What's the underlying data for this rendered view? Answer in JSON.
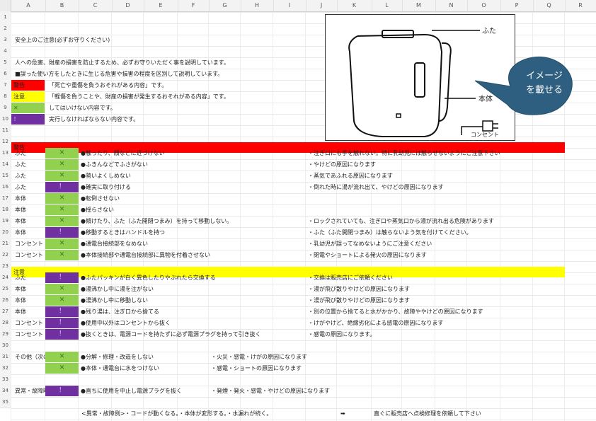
{
  "columns": [
    "A",
    "B",
    "C",
    "D",
    "E",
    "F",
    "G",
    "H",
    "I",
    "J",
    "K",
    "L",
    "M",
    "N",
    "O",
    "P",
    "Q",
    "R"
  ],
  "rows": [
    "1",
    "2",
    "3",
    "4",
    "5",
    "6",
    "7",
    "8",
    "9",
    "10",
    "11",
    "12",
    "13",
    "14",
    "15",
    "16",
    "17",
    "18",
    "19",
    "20",
    "21",
    "22",
    "23",
    "24",
    "25",
    "26",
    "27",
    "28",
    "29",
    "30",
    "31",
    "32",
    "33",
    "34",
    "35"
  ],
  "intro": {
    "title": "安全上のご注意(必ずお守りください)",
    "line1": "人への危害、財産の損害を防止するため、必ずお守りいただく事を説明しています。",
    "line2": "■誤った使い方をしたときに生じる危害や損害の程度を区別して説明しています。"
  },
  "legend": {
    "warning_label": "警告",
    "warning_text": "「死亡や重傷を負うおそれがある内容」です。",
    "caution_label": "注意",
    "caution_text": "「軽傷を負うことや、財産の損害が発生するおそれがある内容」です。",
    "prohibit_symbol": "✕",
    "prohibit_text": "してはいけない内容です。",
    "mandatory_symbol": "！",
    "mandatory_text": "実行しなければならない内容です。"
  },
  "sections": {
    "warning": "警告",
    "caution": "注意",
    "other": "その他（次の点も注意）",
    "abnormal": "異常・故障時は…"
  },
  "table_rows": [
    {
      "row": 13,
      "part": "ふた",
      "type": "x",
      "action": "●触ったり、顔などに近づけない",
      "note": "・注ぎ口にも手を触れない。特に乳幼児には触らせないようにご注意下さい"
    },
    {
      "row": 14,
      "part": "ふた",
      "type": "x",
      "action": "●ふきんなどでふさがない",
      "note": "・やけどの原因になります"
    },
    {
      "row": 15,
      "part": "ふた",
      "type": "x",
      "action": "●勢いよくしめない",
      "note": "・蒸気であふれる原因になります"
    },
    {
      "row": 16,
      "part": "ふた",
      "type": "!",
      "action": "●確実に取り付ける",
      "note": "・倒れた時に湯が流れ出て、やけどの原因になります"
    },
    {
      "row": 17,
      "part": "本体",
      "type": "x",
      "action": "●転倒させない",
      "note": ""
    },
    {
      "row": 18,
      "part": "本体",
      "type": "x",
      "action": "●揺らさない",
      "note": ""
    },
    {
      "row": 19,
      "part": "本体",
      "type": "x",
      "action": "●傾けたり、ふた（ふた開閉つまみ）を持って移動しない。",
      "note": "・ロックされていても、注ぎ口や蒸気口から湯が流れ出る危険があります"
    },
    {
      "row": 20,
      "part": "本体",
      "type": "!",
      "action": "●移動するときはハンドルを持つ",
      "note": "・ふた（ふた開閉つまみ）は触らないよう気を付けてください。"
    },
    {
      "row": 21,
      "part": "コンセント",
      "type": "x",
      "action": "●通電台接続部をなめない",
      "note": "・乳幼児が誤ってなめないようにご注意ください"
    },
    {
      "row": 22,
      "part": "コンセント",
      "type": "x",
      "action": "●本体接続部や通電台接続部に異物を付着させない",
      "note": "・閉電やショートによる発火の原因になります"
    },
    {
      "row": 24,
      "part": "ふた",
      "type": "!",
      "action": "●ふたパッキンが白く異色したりやぶれたら交換する",
      "note": "・交換は販売店にご依頼ください"
    },
    {
      "row": 25,
      "part": "本体",
      "type": "x",
      "action": "●湯沸かし中に湯を注がない",
      "note": "・湯が飛び散りやけどの原因になります"
    },
    {
      "row": 26,
      "part": "本体",
      "type": "x",
      "action": "●湯沸かし中に移動しない",
      "note": "・湯が飛び散りやけどの原因になります"
    },
    {
      "row": 27,
      "part": "本体",
      "type": "!",
      "action": "●残り湯は、注ぎ口から捨てる",
      "note": "・別の位置から捨てると水がかかり、故障ややけどの原因になります"
    },
    {
      "row": 28,
      "part": "コンセント",
      "type": "!",
      "action": "●使用中以外はコンセントから抜く",
      "note": "・けがやけど、絶縁劣化による感電の原因になります"
    },
    {
      "row": 29,
      "part": "コンセント",
      "type": "!",
      "action": "●抜くときは、電源コードを持たずに必ず電源プラグを持って引き抜く",
      "note": "・感電の原因になります。"
    }
  ],
  "other_rows": [
    {
      "row": 31,
      "type": "x",
      "action": "●分解・修理・改造をしない",
      "note": "・火災・感電・けがの原因になります"
    },
    {
      "row": 32,
      "type": "x",
      "action": "●本体・通電台に水をつけない",
      "note": "・感電・ショートの原因になります"
    }
  ],
  "abnormal_row": {
    "type": "!",
    "action": "●直ちに使用を中止し電源プラグを抜く",
    "note": "・発煙・発火・感電・やけどの原因になります"
  },
  "footer": {
    "examples": "<異常・故障例>・コードが動くなる。・本体が変形する。・水漏れが続く。",
    "arrow": "➡",
    "instruction": "直ぐに販売店へ点検修理を依頼して下さい"
  },
  "illustration": {
    "label_lid": "ふた",
    "label_body": "本体",
    "label_outlet": "コンセント",
    "callout_line1": "イメージ",
    "callout_line2": "を載せる"
  },
  "colors": {
    "warning": "#ff0000",
    "caution": "#ffff00",
    "prohibit": "#92d050",
    "mandatory": "#7030a0",
    "callout": "#2e5f80"
  },
  "icons": {
    "prohibit": "cross-mark-icon",
    "mandatory": "exclamation-icon"
  }
}
